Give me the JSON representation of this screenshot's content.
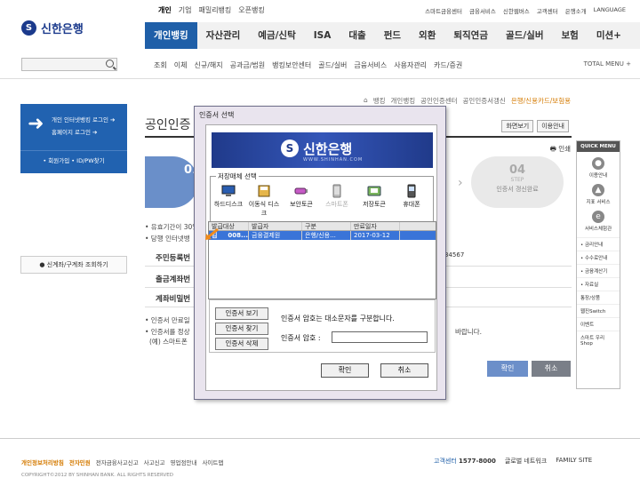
{
  "brand": {
    "mark": "S",
    "name": "신한은행"
  },
  "topnav": [
    "개인",
    "기업",
    "패밀리뱅킹",
    "오픈뱅킹"
  ],
  "utilnav": [
    "스마트금융센터",
    "금융서비스",
    "신한웹버스",
    "고객센터",
    "은행소개",
    "LANGUAGE"
  ],
  "mainnav": [
    "개인뱅킹",
    "자산관리",
    "예금/신탁",
    "ISA",
    "대출",
    "펀드",
    "외환",
    "퇴직연금",
    "골드/실버",
    "보험",
    "미션+"
  ],
  "subnav": [
    "조회",
    "이체",
    "신규/해지",
    "공과금/법원",
    "뱅킹보안센터",
    "골드/실버",
    "금융서비스",
    "사용자관리",
    "카드/증권"
  ],
  "total_menu": "TOTAL MENU +",
  "left": {
    "login1": "개인 인터넷뱅킹 로그인 ➔",
    "login2": "홈페이지 로그인 ➔",
    "login3": "• 회원가입  • ID/PW찾기",
    "account_btn": "● 신계좌/구계좌 조회하기"
  },
  "breadcrumb": [
    "⌂",
    "뱅킹",
    "개인뱅킹",
    "공인인증센터",
    "공인인증서갱신",
    "은행/신용카드/보험용"
  ],
  "page_title": "공인인증",
  "page_buttons": [
    "화면보기",
    "이용안내"
  ],
  "print_label": "인쇄",
  "steps": {
    "step1_num": "01",
    "step1_sub": "STE",
    "step1_text": "사용자 본",
    "step4_num": "04",
    "step4_sub": "STEP",
    "step4_text": "인증서 갱신완료"
  },
  "bullets": [
    "• 유효기간이 30일",
    "• 당행 인터넷뱅"
  ],
  "info_tail": "34567",
  "form_rows": [
    "주민등록번",
    "출금계좌번",
    "계좌비밀번"
  ],
  "notes": [
    "• 인증서 만료일",
    "• 인증서를 정상",
    "(예) 스마트폰"
  ],
  "note_tail": "바랍니다.",
  "page_confirm": "확인",
  "page_cancel": "취소",
  "quick": {
    "header": "QUICK MENU",
    "items": [
      "이용안내",
      "지표 서비스",
      "서비스체험관"
    ],
    "links": [
      "• 금리안내",
      "• 수수료안내",
      "• 금융계산기",
      "• 자료실"
    ],
    "links2": [
      "통장/상품",
      "웹진Switch",
      "이벤트",
      "스마트 우리 Shop"
    ]
  },
  "footer": {
    "links": [
      "개인정보처리방침",
      "전자민원",
      "전자금융사고신고",
      "사고신고",
      "영업점안내",
      "사이트맵"
    ],
    "copyright": "COPYRIGHT©2012 BY SHINHAN BANK. ALL RIGHTS RESERVED",
    "customer_label": "고객센터",
    "customer_num": "1577-8000",
    "global": "글로벌 네트워크",
    "family": "FAMILY SITE"
  },
  "dialog": {
    "title": "인증서 선택",
    "banner_mark": "S",
    "banner_name": "신한은행",
    "banner_sub": "WWW.SHINHAN.COM",
    "media_legend": "저장매체 선택",
    "media": [
      {
        "label": "하드디스크",
        "icon": "hard-disk-icon",
        "enabled": true
      },
      {
        "label": "이동식 디스크",
        "icon": "removable-disk-icon",
        "enabled": true
      },
      {
        "label": "보안토큰",
        "icon": "security-token-icon",
        "enabled": true
      },
      {
        "label": "스마트폰",
        "icon": "smartphone-icon",
        "enabled": false
      },
      {
        "label": "저장토큰",
        "icon": "storage-token-icon",
        "enabled": true
      },
      {
        "label": "휴대폰",
        "icon": "mobile-phone-icon",
        "enabled": true
      }
    ],
    "columns": [
      "발급대상",
      "발급자",
      "구분",
      "만료일자"
    ],
    "rows": [
      {
        "target": "김",
        "code": "008...",
        "issuer": "금융결제원",
        "type": "은행/신용...",
        "expiry": "2017-03-12"
      }
    ],
    "btn_view": "인증서 보기",
    "btn_find": "인증서 찾기",
    "btn_delete": "인증서 삭제",
    "hint": "인증서 암호는 대소문자를 구분합니다.",
    "pw_label": "인증서 암호 :",
    "pw_value": "",
    "ok": "확인",
    "cancel": "취소"
  },
  "colors": {
    "primary": "#1f5fa8",
    "accent": "#d47a00",
    "dialog_bg": "#e9e4ee"
  }
}
